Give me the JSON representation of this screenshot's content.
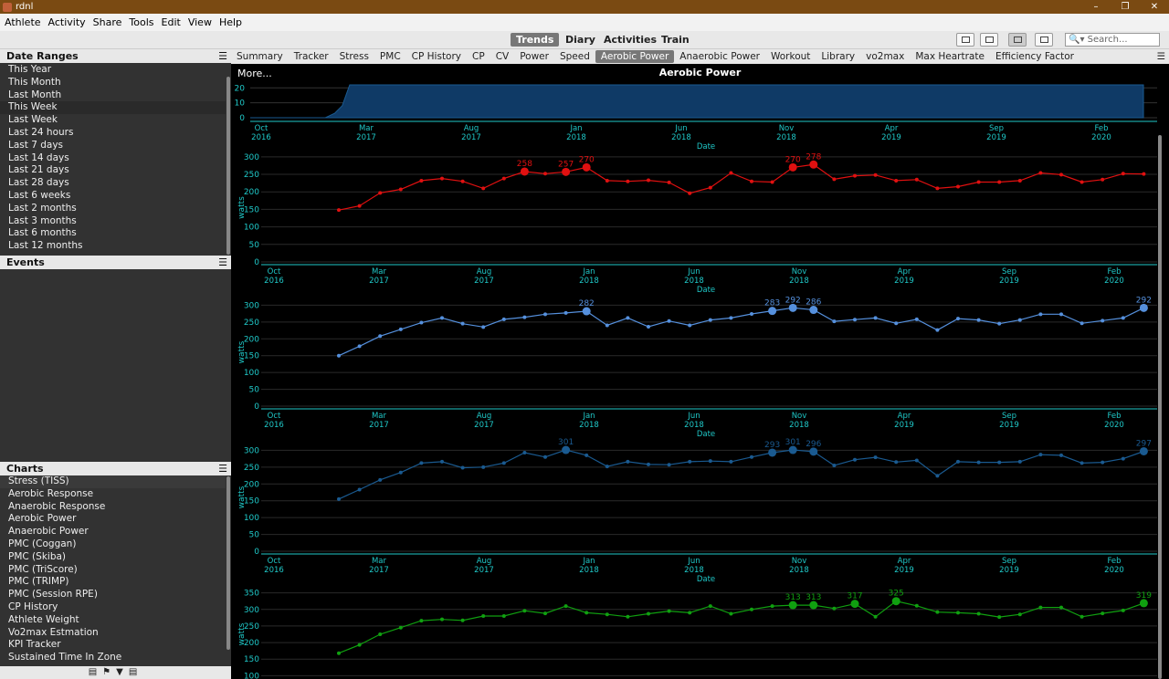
{
  "window": {
    "title": "rdnl",
    "controls": [
      "–",
      "❐",
      "✕"
    ]
  },
  "menu": [
    {
      "label": "Athlete"
    },
    {
      "label": "Activity"
    },
    {
      "label": "Share"
    },
    {
      "label": "Tools"
    },
    {
      "label": "Edit"
    },
    {
      "label": "View"
    },
    {
      "label": "Help"
    }
  ],
  "views": {
    "trends": "Trends",
    "diary": "Diary",
    "activities": "Activities",
    "train": "Train",
    "active": "Trends"
  },
  "search": {
    "placeholder": "Search..."
  },
  "sidebar": {
    "date_ranges": {
      "title": "Date Ranges",
      "items": [
        "This Year",
        "This Month",
        "Last Month",
        "This Week",
        "Last Week",
        "Last 24 hours",
        "Last 7 days",
        "Last 14 days",
        "Last 21 days",
        "Last 28 days",
        "Last 6 weeks",
        "Last 2 months",
        "Last 3 months",
        "Last 6 months",
        "Last 12 months"
      ]
    },
    "events": {
      "title": "Events"
    },
    "charts": {
      "title": "Charts",
      "items": [
        "Stress (TISS)",
        "Aerobic Response",
        "Anaerobic Response",
        "Aerobic Power",
        "Anaerobic Power",
        "PMC (Coggan)",
        "PMC (Skiba)",
        "PMC (TriScore)",
        "PMC (TRIMP)",
        "PMC (Session RPE)",
        "CP History",
        "Athlete Weight",
        "Vo2max Estmation",
        "KPI Tracker",
        "Sustained Time In Zone"
      ]
    }
  },
  "tabs": [
    "Summary",
    "Tracker",
    "Stress",
    "PMC",
    "CP History",
    "CP",
    "CV",
    "Power",
    "Speed",
    "Aerobic Power",
    "Anaerobic Power",
    "Workout",
    "Library",
    "vo2max",
    "Max Heartrate",
    "Efficiency Factor"
  ],
  "active_tab": "Aerobic Power",
  "more_label": "More...",
  "chart_title": "Aerobic Power",
  "chart_data": {
    "type": "line",
    "title": "Aerobic Power",
    "xlabel": "Date",
    "ylabel": "watts",
    "x_ticks": [
      {
        "month": "Oct",
        "year": "2016"
      },
      {
        "month": "Mar",
        "year": "2017"
      },
      {
        "month": "Aug",
        "year": "2017"
      },
      {
        "month": "Jan",
        "year": "2018"
      },
      {
        "month": "Jun",
        "year": "2018"
      },
      {
        "month": "Nov",
        "year": "2018"
      },
      {
        "month": "Apr",
        "year": "2019"
      },
      {
        "month": "Sep",
        "year": "2019"
      },
      {
        "month": "Feb",
        "year": "2020"
      }
    ],
    "overview": {
      "y_ticks": [
        0,
        10,
        20
      ],
      "ylim": [
        0,
        22
      ],
      "color": "#0f3a66",
      "points": [
        [
          0,
          0
        ],
        [
          2.0,
          0
        ],
        [
          2.25,
          3
        ],
        [
          2.45,
          8
        ],
        [
          2.65,
          22
        ],
        [
          23.8,
          22
        ],
        [
          23.8,
          0
        ]
      ]
    },
    "series": [
      {
        "color": "#e01010",
        "ylim": [
          0,
          310
        ],
        "y_ticks": [
          0,
          50,
          100,
          150,
          200,
          250,
          300
        ],
        "values": [
          148,
          160,
          197,
          207,
          232,
          238,
          230,
          210,
          238,
          258,
          252,
          257,
          270,
          232,
          230,
          233,
          227,
          196,
          212,
          254,
          230,
          228,
          270,
          278,
          236,
          246,
          248,
          232,
          235,
          210,
          215,
          228,
          228,
          232,
          254,
          249,
          228,
          235,
          252,
          251
        ],
        "highlights": [
          {
            "i": 9,
            "label": "258"
          },
          {
            "i": 11,
            "label": "257"
          },
          {
            "i": 12,
            "label": "270"
          },
          {
            "i": 22,
            "label": "270"
          },
          {
            "i": 23,
            "label": "278"
          }
        ]
      },
      {
        "color": "#5590dd",
        "ylim": [
          0,
          320
        ],
        "y_ticks": [
          0,
          50,
          100,
          150,
          200,
          250,
          300
        ],
        "values": [
          150,
          178,
          208,
          228,
          248,
          262,
          245,
          235,
          258,
          264,
          273,
          277,
          282,
          240,
          262,
          236,
          253,
          240,
          256,
          262,
          274,
          283,
          292,
          286,
          252,
          257,
          262,
          246,
          258,
          226,
          260,
          256,
          245,
          256,
          273,
          273,
          246,
          254,
          262,
          292
        ],
        "highlights": [
          {
            "i": 12,
            "label": "282"
          },
          {
            "i": 21,
            "label": "283"
          },
          {
            "i": 22,
            "label": "292"
          },
          {
            "i": 23,
            "label": "286"
          },
          {
            "i": 39,
            "label": "292"
          }
        ]
      },
      {
        "color": "#1a5a90",
        "ylim": [
          0,
          320
        ],
        "y_ticks": [
          0,
          50,
          100,
          150,
          200,
          250,
          300
        ],
        "values": [
          155,
          183,
          212,
          234,
          262,
          266,
          248,
          250,
          262,
          293,
          280,
          301,
          285,
          252,
          266,
          258,
          257,
          266,
          268,
          266,
          280,
          293,
          301,
          296,
          255,
          272,
          279,
          265,
          270,
          224,
          266,
          264,
          264,
          266,
          287,
          285,
          262,
          264,
          275,
          297
        ],
        "highlights": [
          {
            "i": 11,
            "label": "301"
          },
          {
            "i": 21,
            "label": "293"
          },
          {
            "i": 22,
            "label": "301"
          },
          {
            "i": 23,
            "label": "296"
          },
          {
            "i": 39,
            "label": "297"
          }
        ]
      },
      {
        "color": "#10a010",
        "ylim": [
          90,
          360
        ],
        "y_ticks": [
          100,
          150,
          200,
          250,
          300,
          350
        ],
        "values": [
          168,
          193,
          225,
          245,
          266,
          270,
          267,
          280,
          280,
          296,
          288,
          310,
          290,
          285,
          278,
          287,
          295,
          290,
          310,
          287,
          300,
          310,
          313,
          313,
          303,
          317,
          278,
          325,
          311,
          292,
          290,
          287,
          277,
          285,
          306,
          306,
          278,
          288,
          297,
          319
        ],
        "highlights": [
          {
            "i": 22,
            "label": "313"
          },
          {
            "i": 23,
            "label": "313"
          },
          {
            "i": 25,
            "label": "317"
          },
          {
            "i": 27,
            "label": "325"
          },
          {
            "i": 39,
            "label": "319"
          }
        ]
      }
    ]
  }
}
